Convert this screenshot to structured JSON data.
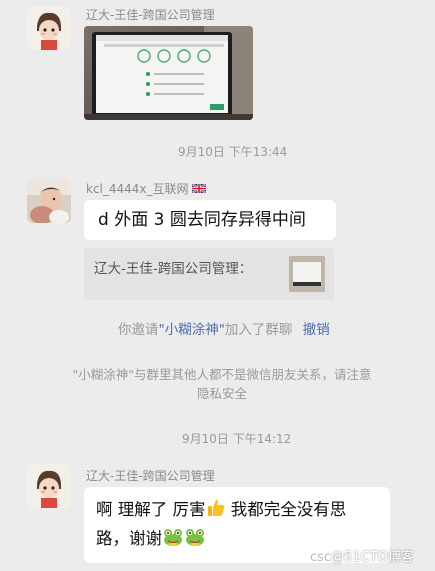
{
  "messages": {
    "m1": {
      "sender": "辽大-王佳-跨国公司管理"
    },
    "t1": "9月10日 下午13:44",
    "m2": {
      "sender": "kcl_4444x_互联网",
      "text": "d 外面 3 圆去同存异得中间",
      "quote_sender": "辽大-王佳-跨国公司管理："
    },
    "invite": {
      "prefix": "你邀请",
      "name": "\"小糊涂神\"",
      "suffix": "加入了群聊",
      "revoke": "撤销"
    },
    "notice": {
      "line1": "\"小糊涂神\"与群里其他人都不是微信朋友关系，请注意",
      "line2": "隐私安全"
    },
    "t2": "9月10日 下午14:12",
    "m3": {
      "sender": "辽大-王佳-跨国公司管理",
      "line1_a": "啊 理解了 厉害",
      "line1_b": " 我都完全没有思",
      "line2": "路，谢谢"
    }
  },
  "watermark": "@51CTO博客",
  "watermark_prefix": "csc",
  "icons": [
    "avatar-cartoon-icon",
    "avatar-photo-icon",
    "thumbs-up-emoji",
    "frog-emoji",
    "uk-flag-icon"
  ]
}
